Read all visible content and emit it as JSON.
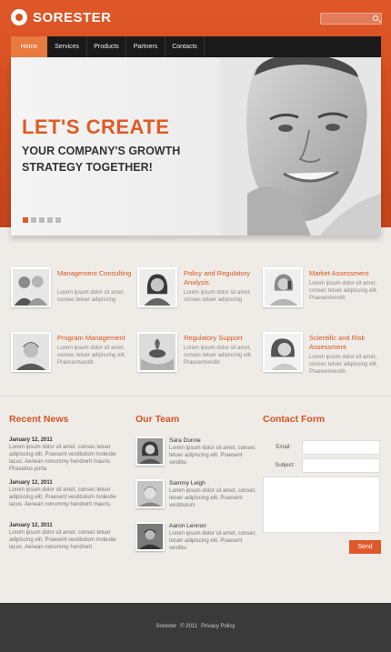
{
  "brand": {
    "name": "SORESTER",
    "accent": "#d9531f"
  },
  "search": {
    "placeholder": "",
    "icon": "search-icon"
  },
  "nav": {
    "items": [
      {
        "label": "Home",
        "active": true
      },
      {
        "label": "Services",
        "active": false
      },
      {
        "label": "Products",
        "active": false
      },
      {
        "label": "Partners",
        "active": false
      },
      {
        "label": "Contacts",
        "active": false
      }
    ]
  },
  "hero": {
    "title": "LET'S CREATE",
    "subtitle_line1": "YOUR COMPANY'S GROWTH",
    "subtitle_line2": "STRATEGY TOGETHER!",
    "slides": 5,
    "active_slide": 1
  },
  "services": [
    {
      "title": "Management Consulting",
      "text": "Lorem ipsum dolor sit amet, consec tetuer adipiscing"
    },
    {
      "title": "Policy and Regulatory Analysis",
      "text": "Lorem ipsum dolor sit amet, consec tetuer adipiscing"
    },
    {
      "title": "Market Assessment",
      "text": "Lorem ipsum dolor sit amet, consec tetuer adipiscing elit. Praesentvestib"
    },
    {
      "title": "Program Management",
      "text": "Lorem ipsum dolor sit amet, consec tetuer adipiscing elit. Praesentvestib"
    },
    {
      "title": "Regulatory Support",
      "text": "Lorem ipsum dolor sit amet, consec tetuer adipiscing elit. Praesentvestib"
    },
    {
      "title": "Scientific and Risk Assessment",
      "text": "Lorem ipsum dolor sit amet, consec tetuer adipiscing elit. Praesentvestib"
    }
  ],
  "news": {
    "title": "Recent News",
    "items": [
      {
        "date": "January 12, 2011",
        "text": "Lorem ipsum dolor sit amet, consec tetuer adipiscing elit. Praesent vestibulum molestie lacus. Aenean nonummy hendrerit mauris. Phasellus porta"
      },
      {
        "date": "January 12, 2011",
        "text": "Lorem ipsum dolor sit amet, consec tetuer adipiscing elit. Praesent vestibulum molestie lacus. Aenean nonummy hendrerit mauris."
      },
      {
        "date": "January 12, 2011",
        "text": "Lorem ipsum dolor sit amet, consec tetuer adipiscing elit. Praesent vestibulum molestie lacus. Aenean nonummy hendrerit"
      }
    ]
  },
  "team": {
    "title": "Our Team",
    "members": [
      {
        "name": "Sara Dunne",
        "text": "Lorem ipsum dolor sit amet, consec tetuer adipiscing elit. Praesent vestibu"
      },
      {
        "name": "Sammy Leigh",
        "text": "Lorem ipsum dolor sit amet, consec tetuer adipiscing elit. Praesent vestibulum"
      },
      {
        "name": "Aaron Lennon",
        "text": "Lorem ipsum dolor sit amet, consec tetuer adipiscing elit. Praesent vestibu"
      }
    ]
  },
  "contact": {
    "title": "Contact Form",
    "email_label": "Email:",
    "subject_label": "Subject:",
    "email_value": "",
    "subject_value": "",
    "message_value": "",
    "send_label": "Send"
  },
  "footer": {
    "brand": "Sorester",
    "copyright": "© 2011",
    "privacy": "Privacy Policy"
  }
}
